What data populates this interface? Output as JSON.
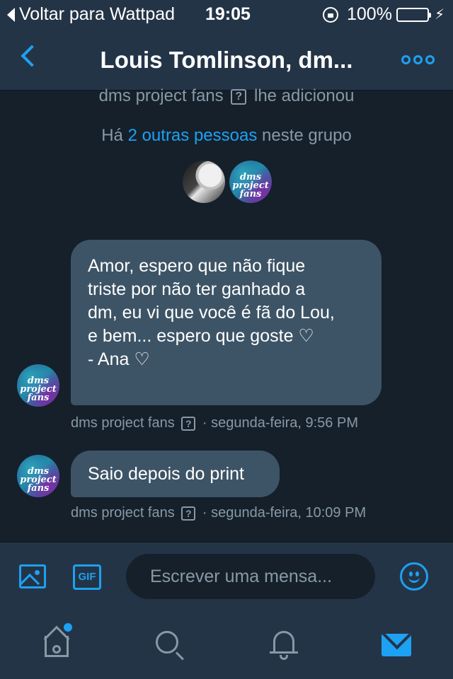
{
  "status_bar": {
    "back_label": "Voltar para Wattpad",
    "time": "19:05",
    "battery": "100%",
    "battery_level": 1.0
  },
  "header": {
    "title": "Louis Tomlinson, dm..."
  },
  "conversation": {
    "system_added": {
      "name": "dms project fans",
      "rest": "lhe adicionou"
    },
    "system_people": {
      "prefix": "Há",
      "link": "2 outras pessoas",
      "suffix": "neste grupo"
    },
    "group_avatars": [
      "photo-avatar",
      "dms-project-avatar"
    ],
    "avatar_text": "dms project fans",
    "messages": [
      {
        "lines": [
          "Amor, espero que não fique",
          "triste por não ter ganhado a",
          "dm, eu vi que você é fã do Lou,",
          "e bem... espero que goste ♡",
          "",
          "- Ana ♡"
        ],
        "sender": "dms project fans",
        "timestamp": "· segunda-feira, 9:56 PM"
      },
      {
        "text": "Saio depois do print",
        "sender": "dms project fans",
        "timestamp": "· segunda-feira, 10:09 PM"
      }
    ]
  },
  "compose": {
    "gif_label": "GIF",
    "placeholder": "Escrever uma mensa..."
  },
  "tabs": [
    "home-icon",
    "search-icon",
    "notifications-icon",
    "messages-icon"
  ],
  "colors": {
    "accent": "#1da1f2",
    "background": "#15202b",
    "bar": "#243447",
    "bubble": "#3d5466",
    "muted": "#8899a6"
  }
}
